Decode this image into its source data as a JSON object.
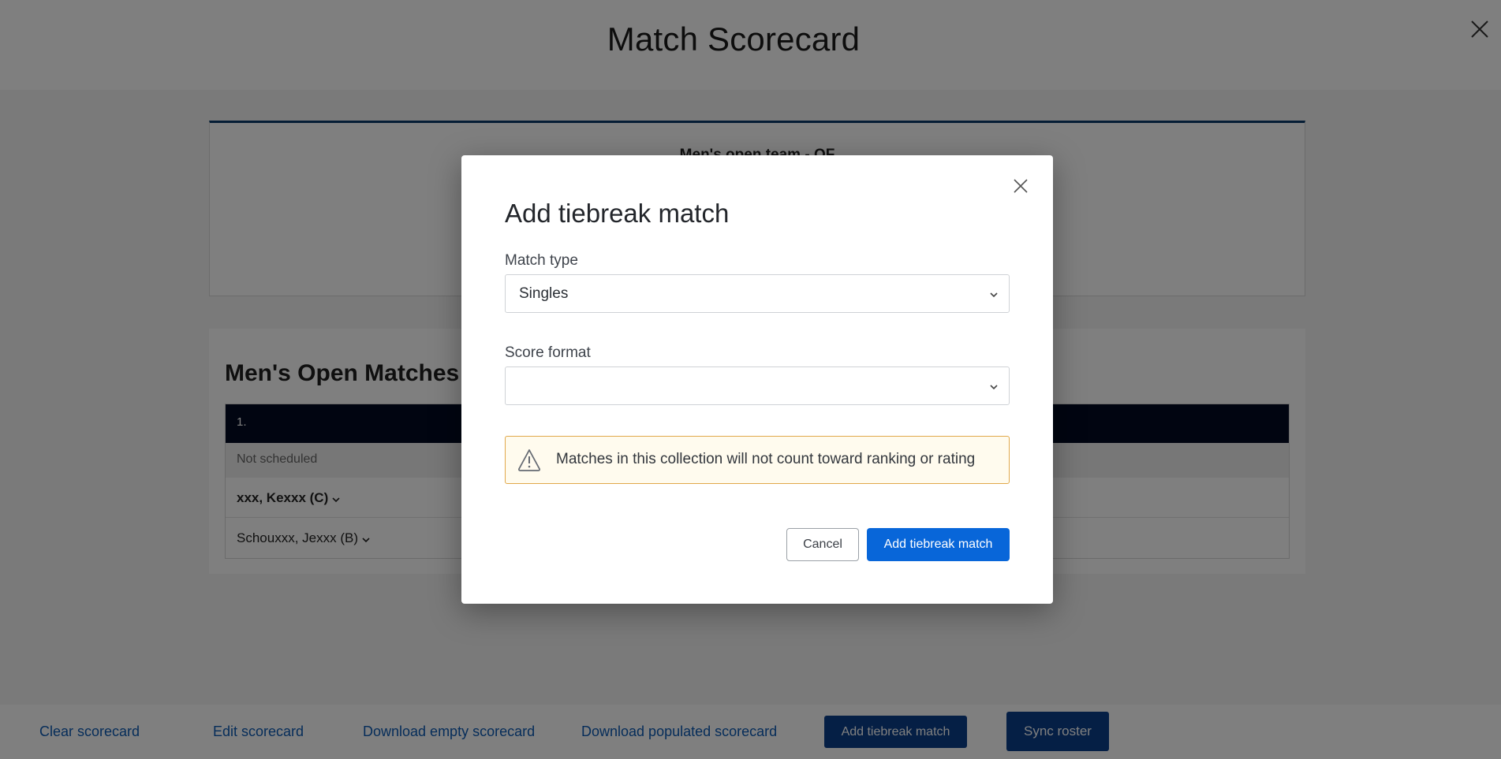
{
  "page": {
    "title": "Match Scorecard",
    "close_icon": "close-icon"
  },
  "summary_card": {
    "title": "Men's open team - QF"
  },
  "matches": {
    "heading": "Men's Open Matches",
    "table": {
      "header_index": "1.",
      "status": "Not scheduled",
      "players": [
        {
          "name": "xxx, Kexxx (C)",
          "bold": true
        },
        {
          "name": "Schouxxx, Jexxx (B)",
          "bold": false
        }
      ]
    }
  },
  "bottom_bar": {
    "links": [
      {
        "label": "Clear scorecard"
      },
      {
        "label": "Edit scorecard"
      },
      {
        "label": "Download empty scorecard"
      },
      {
        "label": "Download populated scorecard"
      }
    ],
    "buttons": [
      {
        "label": "Add tiebreak match"
      },
      {
        "label": "Sync roster"
      }
    ]
  },
  "modal": {
    "title": "Add tiebreak match",
    "close_icon": "close-icon",
    "fields": [
      {
        "label": "Match type",
        "value": "Singles"
      },
      {
        "label": "Score format",
        "value": ""
      }
    ],
    "warning": {
      "icon": "warning-triangle-icon",
      "text": "Matches in this collection will not count toward ranking or rating"
    },
    "cancel_label": "Cancel",
    "submit_label": "Add tiebreak match"
  },
  "colors": {
    "primary": "#0866d9",
    "navy": "#0a3e8a",
    "table_header": "#020b22",
    "warning_bg": "#fffbee",
    "warning_border": "#e1a84a",
    "link": "#0c5ab4"
  }
}
